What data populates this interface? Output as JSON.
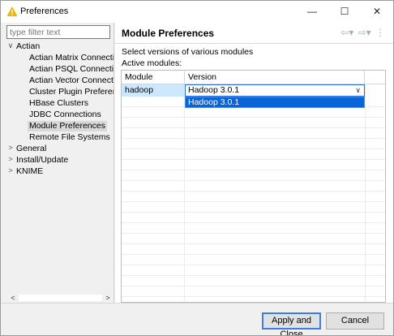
{
  "window": {
    "title": "Preferences",
    "minimize_glyph": "—",
    "maximize_glyph": "☐",
    "close_glyph": "✕"
  },
  "filter": {
    "placeholder": "type filter text"
  },
  "tree": {
    "twisty_expanded": "∨",
    "twisty_collapsed": ">",
    "actian": "Actian",
    "children": [
      "Actian Matrix Connectio",
      "Actian PSQL Connection",
      "Actian Vector Connectio",
      "Cluster Plugin Preferenc",
      "HBase Clusters",
      "JDBC Connections",
      "Module Preferences",
      "Remote File Systems"
    ],
    "selected": "Module Preferences",
    "top_level": [
      "General",
      "Install/Update",
      "KNIME"
    ]
  },
  "scroll": {
    "left_arrow": "<",
    "right_arrow": ">"
  },
  "page": {
    "title": "Module Preferences",
    "nav_icons": [
      "back-arrow-icon",
      "forward-arrow-icon",
      "view-menu-icon"
    ],
    "description": "Select versions of various modules",
    "active_label": "Active modules:",
    "columns": [
      "Module",
      "Version"
    ],
    "row": {
      "module": "hadoop",
      "version": "Hadoop 3.0.1"
    },
    "dropdown_option": "Hadoop 3.0.1"
  },
  "footer": {
    "apply_close": "Apply and Close",
    "cancel": "Cancel"
  },
  "colors": {
    "accent": "#0a64d7",
    "selection": "#cce8ff",
    "warning": "#f2b400"
  }
}
